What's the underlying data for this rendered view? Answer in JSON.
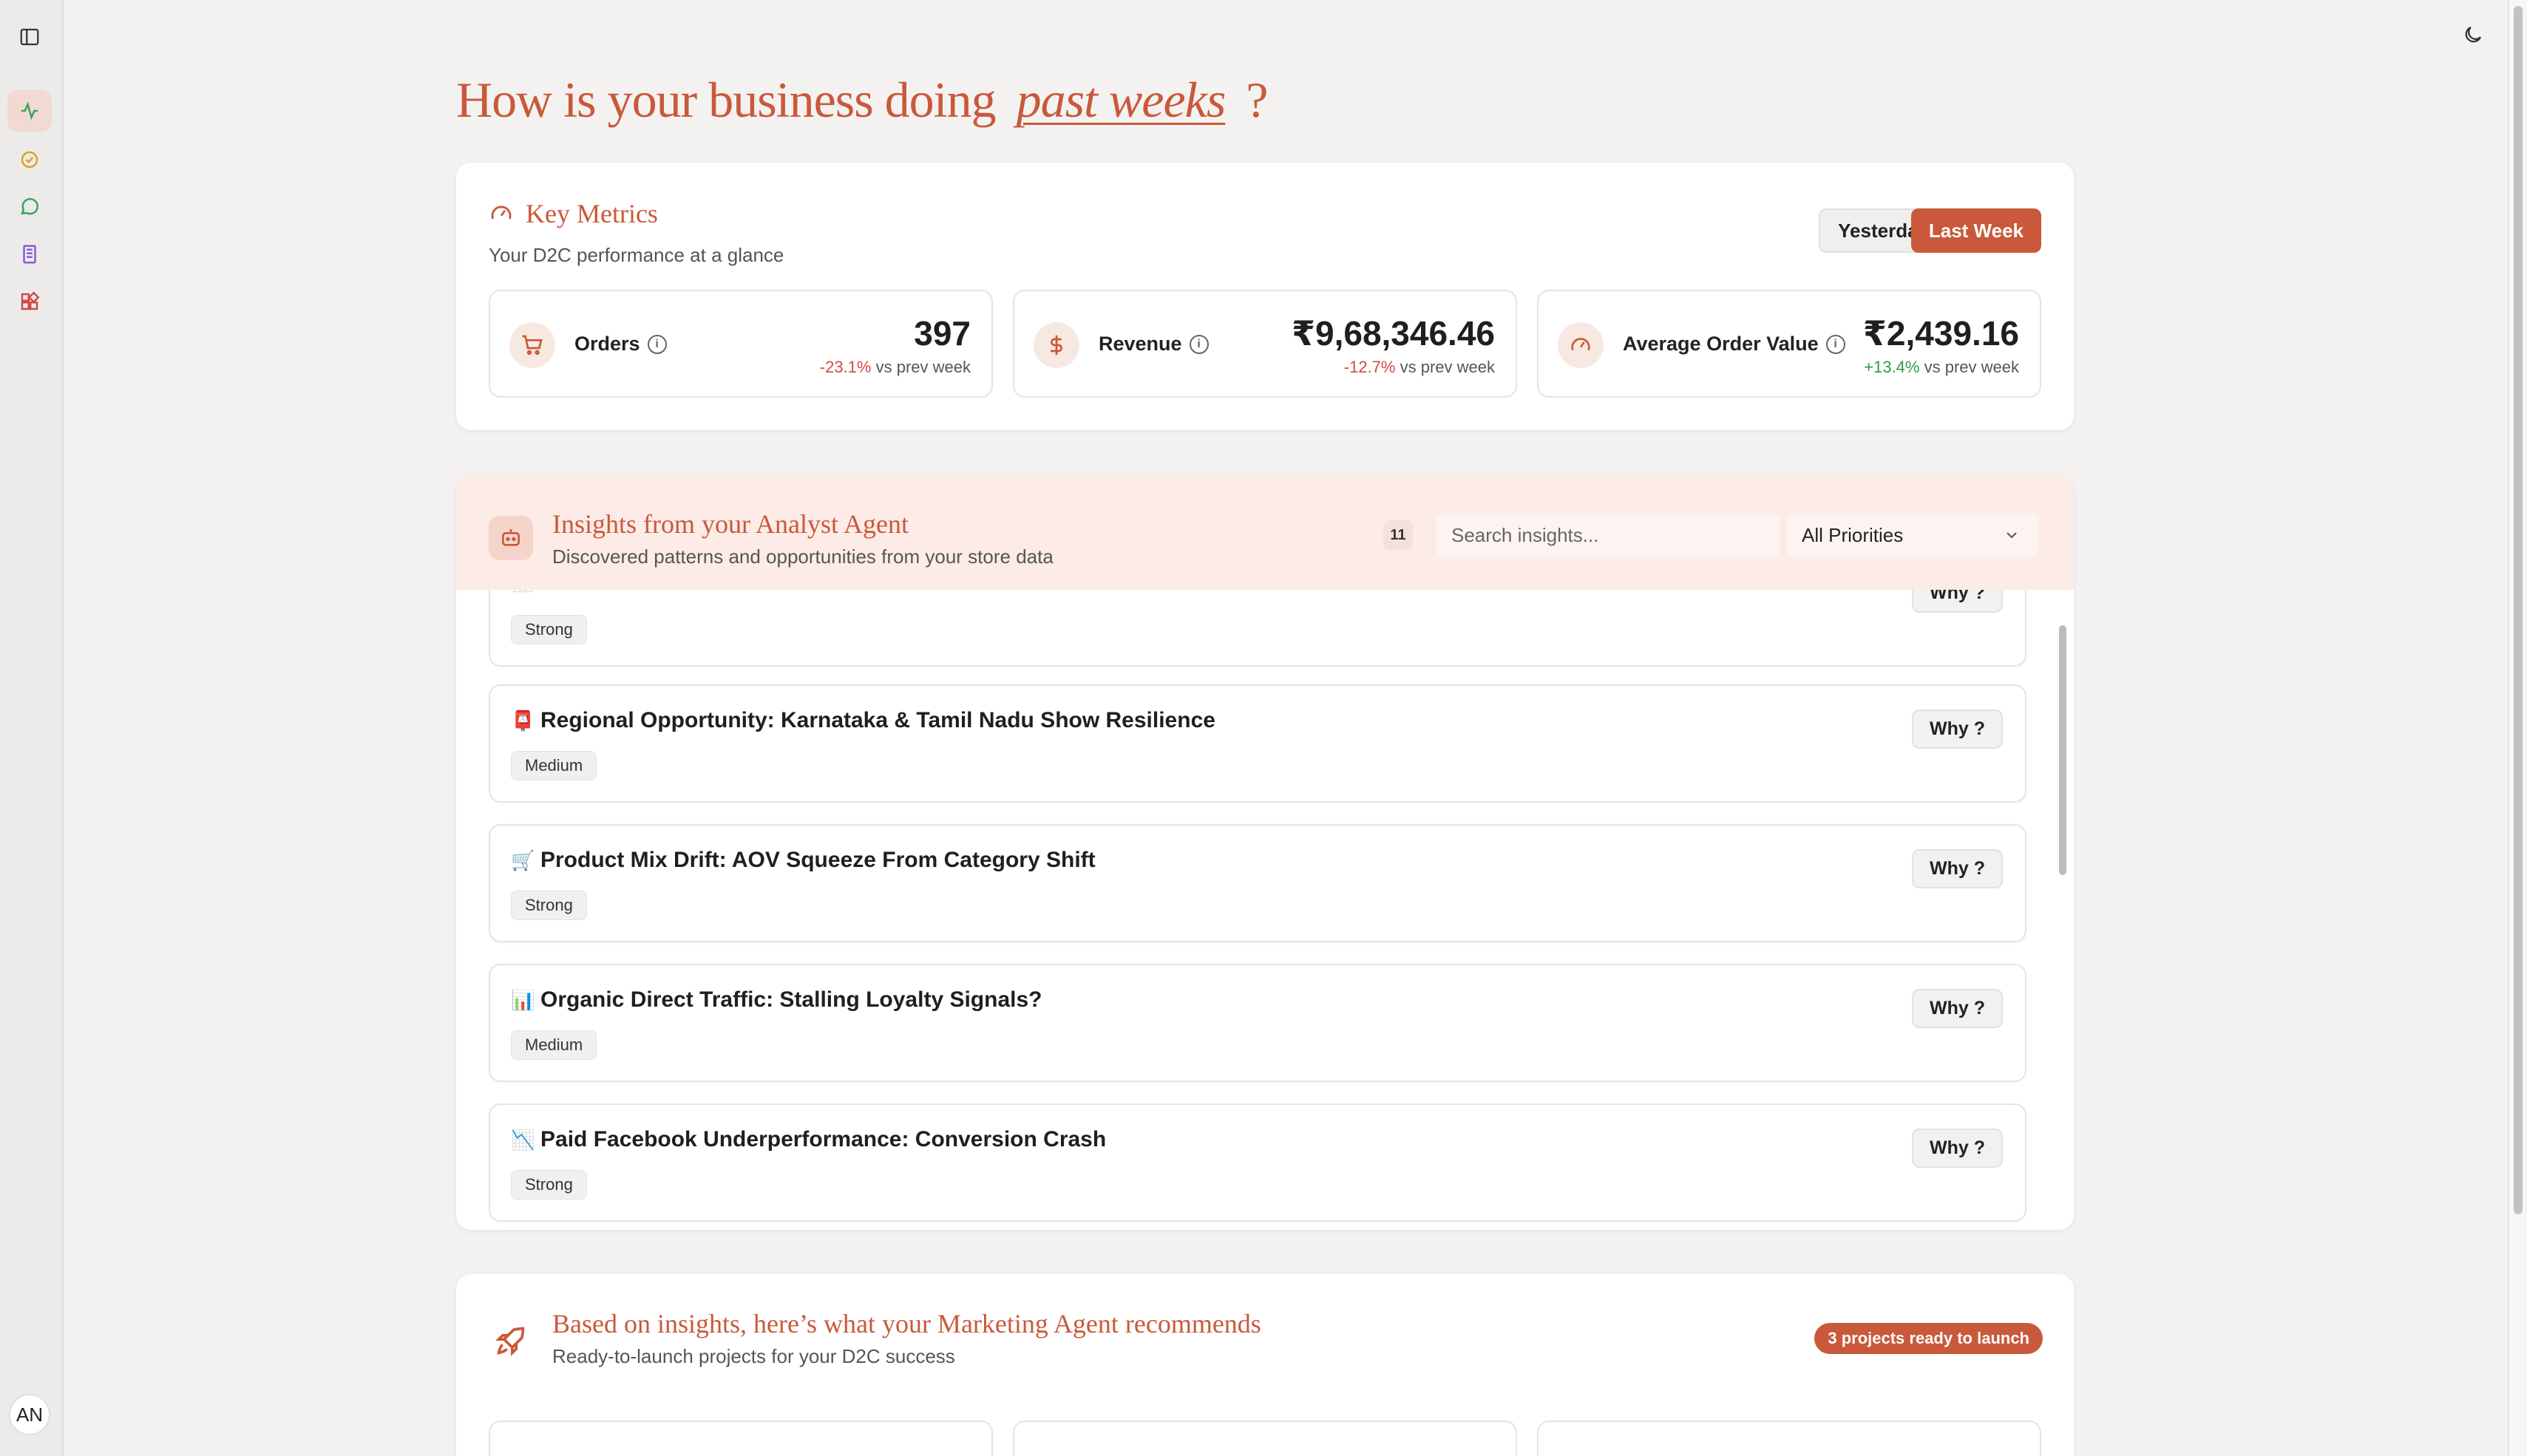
{
  "header": {
    "title_prefix": "How is your business doing",
    "title_period": "past weeks",
    "title_suffix": "?"
  },
  "user": {
    "initials": "AN"
  },
  "key_metrics": {
    "title": "Key Metrics",
    "subtitle": "Your D2C performance at a glance",
    "range_options": [
      "Yesterday",
      "Last Week"
    ],
    "selected_range": "Last Week",
    "metrics": [
      {
        "label": "Orders",
        "value": "397",
        "change": "-23.1%",
        "compare": "vs prev week",
        "trend": "down"
      },
      {
        "label": "Revenue",
        "value": "₹9,68,346.46",
        "change": "-12.7%",
        "compare": "vs prev week",
        "trend": "down"
      },
      {
        "label": "Average Order Value",
        "value": "₹2,439.16",
        "change": "+13.4%",
        "compare": "vs prev week",
        "trend": "up"
      }
    ]
  },
  "insights": {
    "title": "Insights from your Analyst Agent",
    "subtitle": "Discovered patterns and opportunities from your store data",
    "count": "11",
    "search_placeholder": "Search insights...",
    "priority_filter": "All Priorities",
    "why_label": "Why ?",
    "items": [
      {
        "emoji": "📅",
        "title": "",
        "strength": "Strong"
      },
      {
        "emoji": "📮",
        "title": "Regional Opportunity: Karnataka & Tamil Nadu Show Resilience",
        "strength": "Medium"
      },
      {
        "emoji": "🛒",
        "title": "Product Mix Drift: AOV Squeeze From Category Shift",
        "strength": "Strong"
      },
      {
        "emoji": "📊",
        "title": "Organic Direct Traffic: Stalling Loyalty Signals?",
        "strength": "Medium"
      },
      {
        "emoji": "📉",
        "title": "Paid Facebook Underperformance: Conversion Crash",
        "strength": "Strong"
      }
    ]
  },
  "recommendations": {
    "title": "Based on insights, here’s what your Marketing Agent recommends",
    "subtitle": "Ready-to-launch projects for your D2C success",
    "badge": "3 projects ready to launch"
  },
  "colors": {
    "accent": "#c9593a",
    "negative": "#d24848",
    "positive": "#2f9a4a"
  }
}
